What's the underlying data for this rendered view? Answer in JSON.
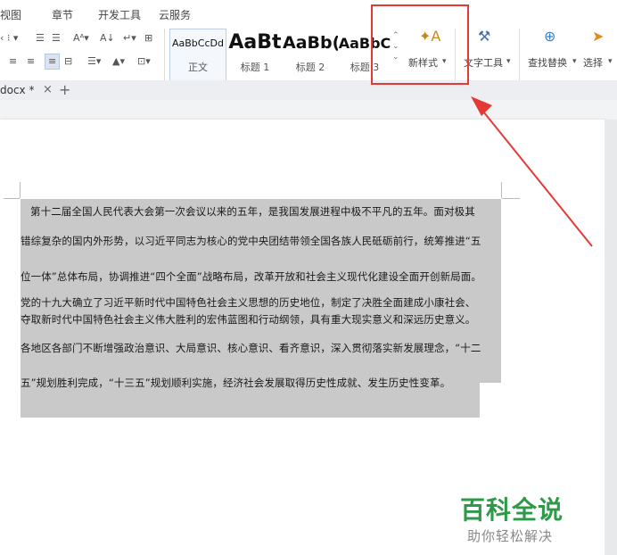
{
  "menu": {
    "items": [
      "视图",
      "章节",
      "开发工具",
      "云服务"
    ]
  },
  "styles": [
    {
      "sample": "AaBbCcDd",
      "name": "正文"
    },
    {
      "sample": "AaBt",
      "name": "标题 1"
    },
    {
      "sample": "AaBb(",
      "name": "标题 2"
    },
    {
      "sample": "AaBbC",
      "name": "标题 3"
    }
  ],
  "toolbar": {
    "new_style": "新样式",
    "text_tools": "文字工具",
    "find_replace": "查找替换",
    "select": "选择"
  },
  "tab": {
    "doc_name": "docx *",
    "close": "×",
    "add": "+"
  },
  "document": {
    "lines": [
      "第十二届全国人民代表大会第一次会议以来的五年，是我国发展进程中极不平凡的五年。面对极其",
      "错综复杂的国内外形势，以习近平同志为核心的党中央团结带领全国各族人民砥砺前行，统筹推进“五",
      "位一体”总体布局，协调推进“四个全面”战略布局，改革开放和社会主义现代化建设全面开创新局面。",
      "党的十九大确立了习近平新时代中国特色社会主义思想的历史地位，制定了决胜全面建成小康社会、",
      "夺取新时代中国特色社会主义伟大胜利的宏伟蓝图和行动纲领，具有重大现实意义和深远历史意义。",
      "各地区各部门不断增强政治意识、大局意识、核心意识、看齐意识，深入贯彻落实新发展理念，“十二",
      "五”规划胜利完成，“十三五”规划顺利实施，经济社会发展取得历史性成就、发生历史性变革。"
    ]
  },
  "watermark": {
    "title": "百科全说",
    "subtitle": "助你轻松解决"
  },
  "colors": {
    "highlight": "#e53935",
    "watermark_green": "#2d9a48",
    "selection": "#c9c9c9"
  }
}
